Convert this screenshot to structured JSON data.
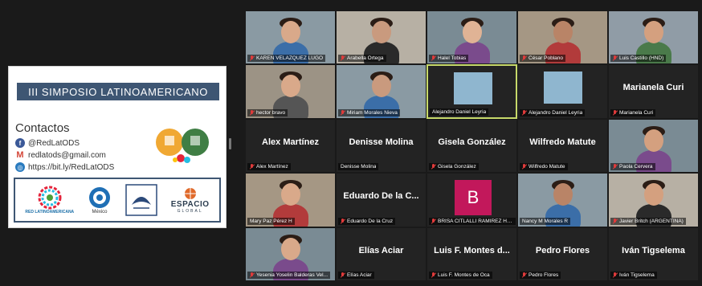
{
  "slide": {
    "banner": "III SIMPOSIO LATINOAMERICANO",
    "contacts_title": "Contactos",
    "contacts": [
      {
        "icon": "facebook-icon",
        "text": "@RedLatODS"
      },
      {
        "icon": "gmail-icon",
        "text": "redlatods@gmail.com"
      },
      {
        "icon": "web-icon",
        "text": "https://bit.ly/RedLatODS"
      }
    ],
    "logos": {
      "red": "RED LATINOAMERICANA",
      "mexico": "México",
      "espacio": "ESPACIO",
      "espacio_sub": "GLOBAL"
    }
  },
  "participants": [
    {
      "name": "KAREN VELAZQUEZ LUGO",
      "video": true,
      "muted": true
    },
    {
      "name": "Arabella Ortega",
      "video": true,
      "muted": true
    },
    {
      "name": "Halel Tobias",
      "video": true,
      "muted": true
    },
    {
      "name": "César Poblano",
      "video": true,
      "muted": true
    },
    {
      "name": "Luis Castillo (HND)",
      "video": true,
      "muted": true
    },
    {
      "name": "hector bravo",
      "video": true,
      "muted": true
    },
    {
      "name": "Miriam Morales Nieva",
      "video": true,
      "muted": true
    },
    {
      "name": "Alejandro Daniel Leyria",
      "video": true,
      "muted": false,
      "active": true
    },
    {
      "name": "Alejandro Daniel Leyria",
      "video": true,
      "muted": true
    },
    {
      "name": "Marianela Curi",
      "big_name": "Marianela Curi",
      "video": false,
      "muted": true
    },
    {
      "name": "Alex Martínez",
      "big_name": "Alex Martínez",
      "video": false,
      "muted": true
    },
    {
      "name": "Denisse Molina",
      "big_name": "Denisse Molina",
      "video": false,
      "muted": false
    },
    {
      "name": "Gisela González",
      "big_name": "Gisela González",
      "video": false,
      "muted": true
    },
    {
      "name": "Wilfredo Matute",
      "big_name": "Wilfredo Matute",
      "video": false,
      "muted": true
    },
    {
      "name": "Paola Cervera",
      "video": true,
      "muted": true
    },
    {
      "name": "Mary Paz Pérez H",
      "video": true,
      "muted": false
    },
    {
      "name": "Eduardo De la Cruz",
      "big_name": "Eduardo De la C...",
      "video": false,
      "muted": true
    },
    {
      "name": "BRISA CITLALLI RAMIREZ HE...",
      "avatar_letter": "B",
      "video": false,
      "muted": true
    },
    {
      "name": "Nancy M Morales R",
      "video": true,
      "muted": false
    },
    {
      "name": "Javier Britch (ARGENTINA)",
      "video": true,
      "muted": true
    },
    {
      "name": "Yesenia Yoselin Balderas Vel...",
      "video": true,
      "muted": true
    },
    {
      "name": "Elías Aciar",
      "big_name": "Elías Aciar",
      "video": false,
      "muted": true
    },
    {
      "name": "Luis F. Montes de Oca",
      "big_name": "Luis F. Montes d...",
      "video": false,
      "muted": true
    },
    {
      "name": "Pedro Flores",
      "big_name": "Pedro Flores",
      "video": false,
      "muted": true
    },
    {
      "name": "Iván Tigselema",
      "big_name": "Iván Tigselema",
      "video": false,
      "muted": true
    }
  ],
  "colors": {
    "banner": "#3e5673",
    "mic_muted": "#e03b3b",
    "active_border": "#c7d96a",
    "avatar_b": "#c2185b"
  }
}
